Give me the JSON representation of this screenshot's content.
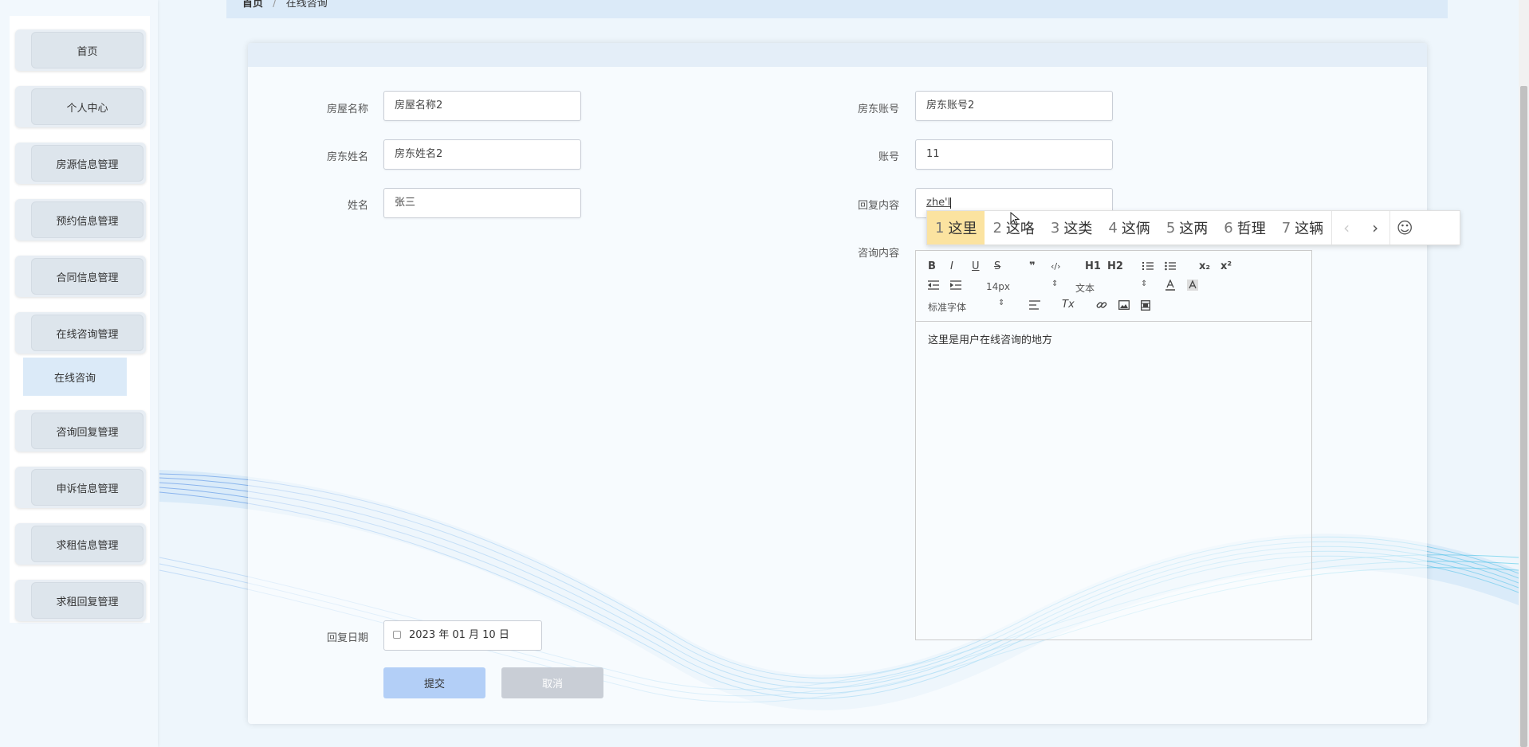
{
  "breadcrumb": {
    "home": "首页",
    "separator": "/",
    "current": "在线咨询"
  },
  "sidebar": {
    "items": [
      {
        "label": "首页"
      },
      {
        "label": "个人中心"
      },
      {
        "label": "房源信息管理"
      },
      {
        "label": "预约信息管理"
      },
      {
        "label": "合同信息管理"
      },
      {
        "label": "在线咨询管理"
      },
      {
        "label": "咨询回复管理"
      },
      {
        "label": "申诉信息管理"
      },
      {
        "label": "求租信息管理"
      },
      {
        "label": "求租回复管理"
      }
    ],
    "submenu_label": "在线咨询"
  },
  "form": {
    "house_name": {
      "label": "房屋名称",
      "value": "房屋名称2"
    },
    "landlord_account": {
      "label": "房东账号",
      "value": "房东账号2"
    },
    "landlord_name": {
      "label": "房东姓名",
      "value": "房东姓名2"
    },
    "account": {
      "label": "账号",
      "value": "11"
    },
    "name": {
      "label": "姓名",
      "value": "张三"
    },
    "reply_content": {
      "label": "回复内容",
      "value": "zhe'l"
    },
    "consult_content": {
      "label": "咨询内容",
      "value": "这里是用户在线咨询的地方"
    },
    "reply_date": {
      "label": "回复日期",
      "value": "2023 年 01 月 10 日"
    },
    "submit_label": "提交",
    "cancel_label": "取消"
  },
  "ime": {
    "candidates": [
      {
        "num": "1",
        "text": "这里"
      },
      {
        "num": "2",
        "text": "这咯"
      },
      {
        "num": "3",
        "text": "这类"
      },
      {
        "num": "4",
        "text": "这俩"
      },
      {
        "num": "5",
        "text": "这两"
      },
      {
        "num": "6",
        "text": "哲理"
      },
      {
        "num": "7",
        "text": "这辆"
      }
    ],
    "prev": "‹",
    "next": "›",
    "emoji": "☺"
  },
  "editor": {
    "font_size": "14px",
    "block_type": "文本",
    "font_family": "标准字体",
    "tools": {
      "bold": "B",
      "italic": "I",
      "underline": "U",
      "strike": "S",
      "h1": "H1",
      "h2": "H2",
      "quote": "❞",
      "code": "‹/›",
      "sub": "x₂",
      "sup": "x²",
      "clean": "Tx"
    }
  },
  "colors": {
    "accent": "#b3cff7",
    "panel": "#dbeaf8",
    "cancel": "#c9ced6",
    "ime_selected": "#fbe3a0"
  }
}
